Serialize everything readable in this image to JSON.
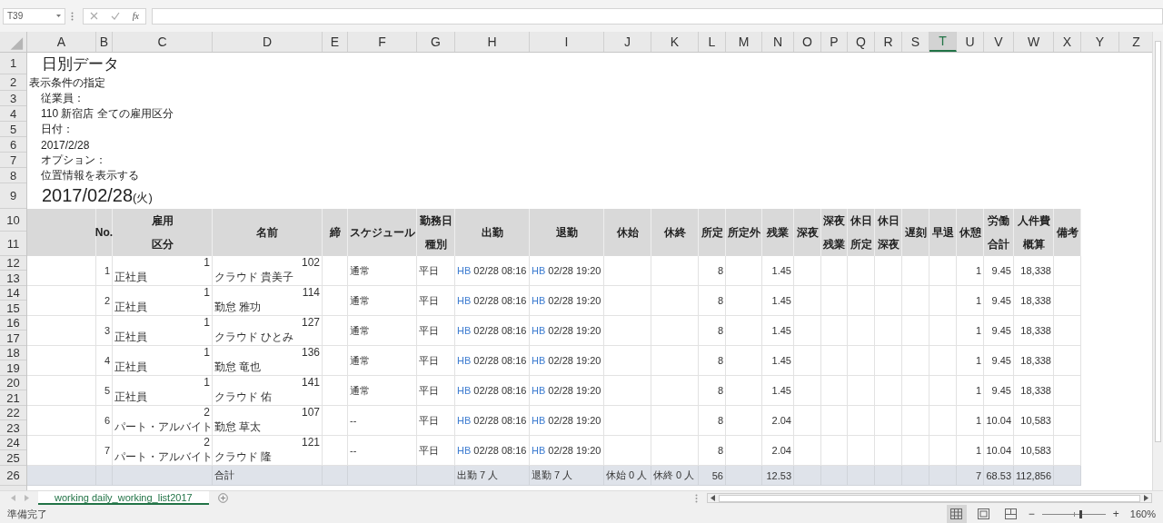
{
  "formula_bar": {
    "name_box": "T39",
    "function_button": "fx"
  },
  "columns": [
    {
      "label": "A",
      "selected": false
    },
    {
      "label": "B",
      "selected": false
    },
    {
      "label": "C",
      "selected": false
    },
    {
      "label": "D",
      "selected": false
    },
    {
      "label": "E",
      "selected": false
    },
    {
      "label": "F",
      "selected": false
    },
    {
      "label": "G",
      "selected": false
    },
    {
      "label": "H",
      "selected": false
    },
    {
      "label": "I",
      "selected": false
    },
    {
      "label": "J",
      "selected": false
    },
    {
      "label": "K",
      "selected": false
    },
    {
      "label": "L",
      "selected": false
    },
    {
      "label": "M",
      "selected": false
    },
    {
      "label": "N",
      "selected": false
    },
    {
      "label": "O",
      "selected": false
    },
    {
      "label": "P",
      "selected": false
    },
    {
      "label": "Q",
      "selected": false
    },
    {
      "label": "R",
      "selected": false
    },
    {
      "label": "S",
      "selected": false
    },
    {
      "label": "T",
      "selected": true
    },
    {
      "label": "U",
      "selected": false
    },
    {
      "label": "V",
      "selected": false
    },
    {
      "label": "W",
      "selected": false
    },
    {
      "label": "X",
      "selected": false
    },
    {
      "label": "Y",
      "selected": false
    },
    {
      "label": "Z",
      "selected": false
    }
  ],
  "row_numbers": [
    "1",
    "2",
    "3",
    "4",
    "5",
    "6",
    "7",
    "8",
    "9",
    "10",
    "11",
    "12",
    "13",
    "14",
    "15",
    "16",
    "17",
    "18",
    "19",
    "20",
    "21",
    "22",
    "23",
    "24",
    "25",
    "26"
  ],
  "report": {
    "title": "日別データ",
    "conditions_heading": "表示条件の指定",
    "condition_lines": [
      "従業員：",
      "110 新宿店 全ての雇用区分",
      "日付：",
      "2017/2/28",
      "オプション：",
      "位置情報を表示する"
    ],
    "date": "2017/02/28",
    "weekday": "(火)"
  },
  "table": {
    "headers": [
      {
        "lines": [
          "No."
        ]
      },
      {
        "lines": [
          "雇用",
          "区分"
        ]
      },
      {
        "lines": [
          "名前"
        ]
      },
      {
        "lines": [
          "締"
        ]
      },
      {
        "lines": [
          "スケジュール"
        ]
      },
      {
        "lines": [
          "勤務日",
          "種別"
        ]
      },
      {
        "lines": [
          "出勤"
        ]
      },
      {
        "lines": [
          "退勤"
        ]
      },
      {
        "lines": [
          "休始"
        ]
      },
      {
        "lines": [
          "休終"
        ]
      },
      {
        "lines": [
          "所定"
        ]
      },
      {
        "lines": [
          "所定外"
        ]
      },
      {
        "lines": [
          "残業"
        ]
      },
      {
        "lines": [
          "深夜"
        ]
      },
      {
        "lines": [
          "深夜",
          "残業"
        ]
      },
      {
        "lines": [
          "休日",
          "所定"
        ]
      },
      {
        "lines": [
          "休日",
          "深夜"
        ]
      },
      {
        "lines": [
          "遅刻"
        ]
      },
      {
        "lines": [
          "早退"
        ]
      },
      {
        "lines": [
          "休憩"
        ]
      },
      {
        "lines": [
          "労働",
          "合計"
        ]
      },
      {
        "lines": [
          "人件費",
          "概算"
        ]
      },
      {
        "lines": [
          "備考"
        ]
      }
    ],
    "rows": [
      {
        "no": "1",
        "type_code": "1",
        "type": "正社員",
        "employee_code": "102",
        "name": "クラウド 貴美子",
        "schedule": "通常",
        "day_type": "平日",
        "clock_in_tag": "HB",
        "clock_in": "02/28 08:16",
        "clock_out_tag": "HB",
        "clock_out": "02/28 19:20",
        "scheduled": "8",
        "overtime": "1.45",
        "break": "1",
        "total": "9.45",
        "cost": "18,338"
      },
      {
        "no": "2",
        "type_code": "1",
        "type": "正社員",
        "employee_code": "114",
        "name": "勤怠 雅功",
        "schedule": "通常",
        "day_type": "平日",
        "clock_in_tag": "HB",
        "clock_in": "02/28 08:16",
        "clock_out_tag": "HB",
        "clock_out": "02/28 19:20",
        "scheduled": "8",
        "overtime": "1.45",
        "break": "1",
        "total": "9.45",
        "cost": "18,338"
      },
      {
        "no": "3",
        "type_code": "1",
        "type": "正社員",
        "employee_code": "127",
        "name": "クラウド ひとみ",
        "schedule": "通常",
        "day_type": "平日",
        "clock_in_tag": "HB",
        "clock_in": "02/28 08:16",
        "clock_out_tag": "HB",
        "clock_out": "02/28 19:20",
        "scheduled": "8",
        "overtime": "1.45",
        "break": "1",
        "total": "9.45",
        "cost": "18,338"
      },
      {
        "no": "4",
        "type_code": "1",
        "type": "正社員",
        "employee_code": "136",
        "name": "勤怠 竜也",
        "schedule": "通常",
        "day_type": "平日",
        "clock_in_tag": "HB",
        "clock_in": "02/28 08:16",
        "clock_out_tag": "HB",
        "clock_out": "02/28 19:20",
        "scheduled": "8",
        "overtime": "1.45",
        "break": "1",
        "total": "9.45",
        "cost": "18,338"
      },
      {
        "no": "5",
        "type_code": "1",
        "type": "正社員",
        "employee_code": "141",
        "name": "クラウド 佑",
        "schedule": "通常",
        "day_type": "平日",
        "clock_in_tag": "HB",
        "clock_in": "02/28 08:16",
        "clock_out_tag": "HB",
        "clock_out": "02/28 19:20",
        "scheduled": "8",
        "overtime": "1.45",
        "break": "1",
        "total": "9.45",
        "cost": "18,338"
      },
      {
        "no": "6",
        "type_code": "2",
        "type": "パート・アルバイト",
        "employee_code": "107",
        "name": "勤怠 草太",
        "schedule": "--",
        "day_type": "平日",
        "clock_in_tag": "HB",
        "clock_in": "02/28 08:16",
        "clock_out_tag": "HB",
        "clock_out": "02/28 19:20",
        "scheduled": "8",
        "overtime": "2.04",
        "break": "1",
        "total": "10.04",
        "cost": "10,583"
      },
      {
        "no": "7",
        "type_code": "2",
        "type": "パート・アルバイト",
        "employee_code": "121",
        "name": "クラウド 隆",
        "schedule": "--",
        "day_type": "平日",
        "clock_in_tag": "HB",
        "clock_in": "02/28 08:16",
        "clock_out_tag": "HB",
        "clock_out": "02/28 19:20",
        "scheduled": "8",
        "overtime": "2.04",
        "break": "1",
        "total": "10.04",
        "cost": "10,583"
      }
    ],
    "total": {
      "label": "合計",
      "clock_in": "出勤 7 人",
      "clock_out": "退勤 7 人",
      "break_start": "休始 0 人",
      "break_end": "休終 0 人",
      "scheduled": "56",
      "overtime": "12.53",
      "break": "7",
      "total": "68.53",
      "cost": "112,856"
    }
  },
  "sheet_tabs": [
    {
      "label": "working daily_working_list2017",
      "selected": true
    }
  ],
  "status_bar": {
    "status": "準備完了",
    "views": [
      {
        "kind": "normal",
        "selected": true
      },
      {
        "kind": "page_layout",
        "selected": false
      },
      {
        "kind": "page_break",
        "selected": false
      }
    ],
    "zoom_out": "−",
    "zoom_in": "+",
    "zoom": {
      "level": 0.6,
      "value": "160%"
    }
  }
}
